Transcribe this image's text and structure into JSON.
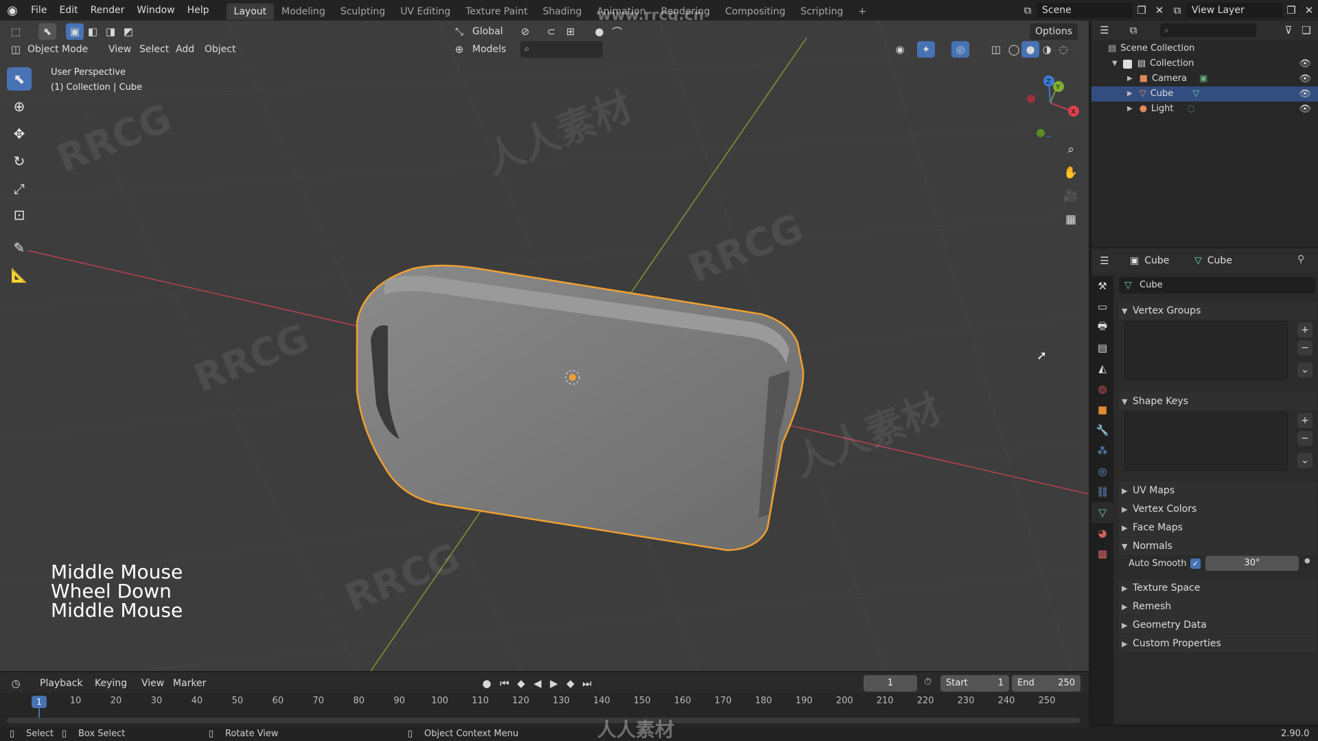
{
  "topbar": {
    "menus": [
      "File",
      "Edit",
      "Render",
      "Window",
      "Help"
    ],
    "workspaces": [
      "Layout",
      "Modeling",
      "Sculpting",
      "UV Editing",
      "Texture Paint",
      "Shading",
      "Animation",
      "Rendering",
      "Compositing",
      "Scripting"
    ],
    "active_workspace": "Layout",
    "add_tab": "+",
    "scene_label": "Scene",
    "view_layer_label": "View Layer",
    "url_watermark": "www.rrcg.cn"
  },
  "viewport": {
    "mode": "Object Mode",
    "menus": [
      "View",
      "Select",
      "Add",
      "Object"
    ],
    "transform_orientation": "Global",
    "collection_filter": "Models",
    "options_label": "Options",
    "perspective": "User Perspective",
    "context": "(1) Collection | Cube",
    "key_overlay": [
      "Middle Mouse",
      "Wheel Down",
      "Middle Mouse"
    ],
    "gizmo_axes": {
      "x": "X",
      "y": "Y",
      "z": "Z"
    },
    "watermarks": [
      "RRCG",
      "人人素材"
    ]
  },
  "outliner": {
    "root": "Scene Collection",
    "collection": "Collection",
    "items": [
      {
        "label": "Camera",
        "selected": false
      },
      {
        "label": "Cube",
        "selected": true
      },
      {
        "label": "Light",
        "selected": false
      }
    ]
  },
  "properties": {
    "object_name": "Cube",
    "data_name": "Cube",
    "mesh_field": "Cube",
    "panels": {
      "vertex_groups": "Vertex Groups",
      "shape_keys": "Shape Keys",
      "uv_maps": "UV Maps",
      "vertex_colors": "Vertex Colors",
      "face_maps": "Face Maps",
      "normals": "Normals",
      "auto_smooth_label": "Auto Smooth",
      "auto_smooth_angle": "30°",
      "auto_smooth_checked": true,
      "texture_space": "Texture Space",
      "remesh": "Remesh",
      "geometry_data": "Geometry Data",
      "custom_properties": "Custom Properties"
    }
  },
  "timeline": {
    "menus": [
      "Playback",
      "Keying",
      "View",
      "Marker"
    ],
    "current_frame": "1",
    "start_label": "Start",
    "start_value": "1",
    "end_label": "End",
    "end_value": "250",
    "ticks": [
      "1",
      "10",
      "20",
      "30",
      "40",
      "50",
      "60",
      "70",
      "80",
      "90",
      "100",
      "110",
      "120",
      "130",
      "140",
      "150",
      "160",
      "170",
      "180",
      "190",
      "200",
      "210",
      "220",
      "230",
      "240",
      "250"
    ]
  },
  "statusbar": {
    "select": "Select",
    "box_select": "Box Select",
    "rotate_view": "Rotate View",
    "context_menu": "Object Context Menu",
    "version": "2.90.0"
  },
  "colors": {
    "accent": "#4772b3",
    "selection_outline": "#f0a030",
    "x_axis": "#c0404a",
    "y_axis": "#6f9a30",
    "z_axis": "#3d7bd6"
  }
}
